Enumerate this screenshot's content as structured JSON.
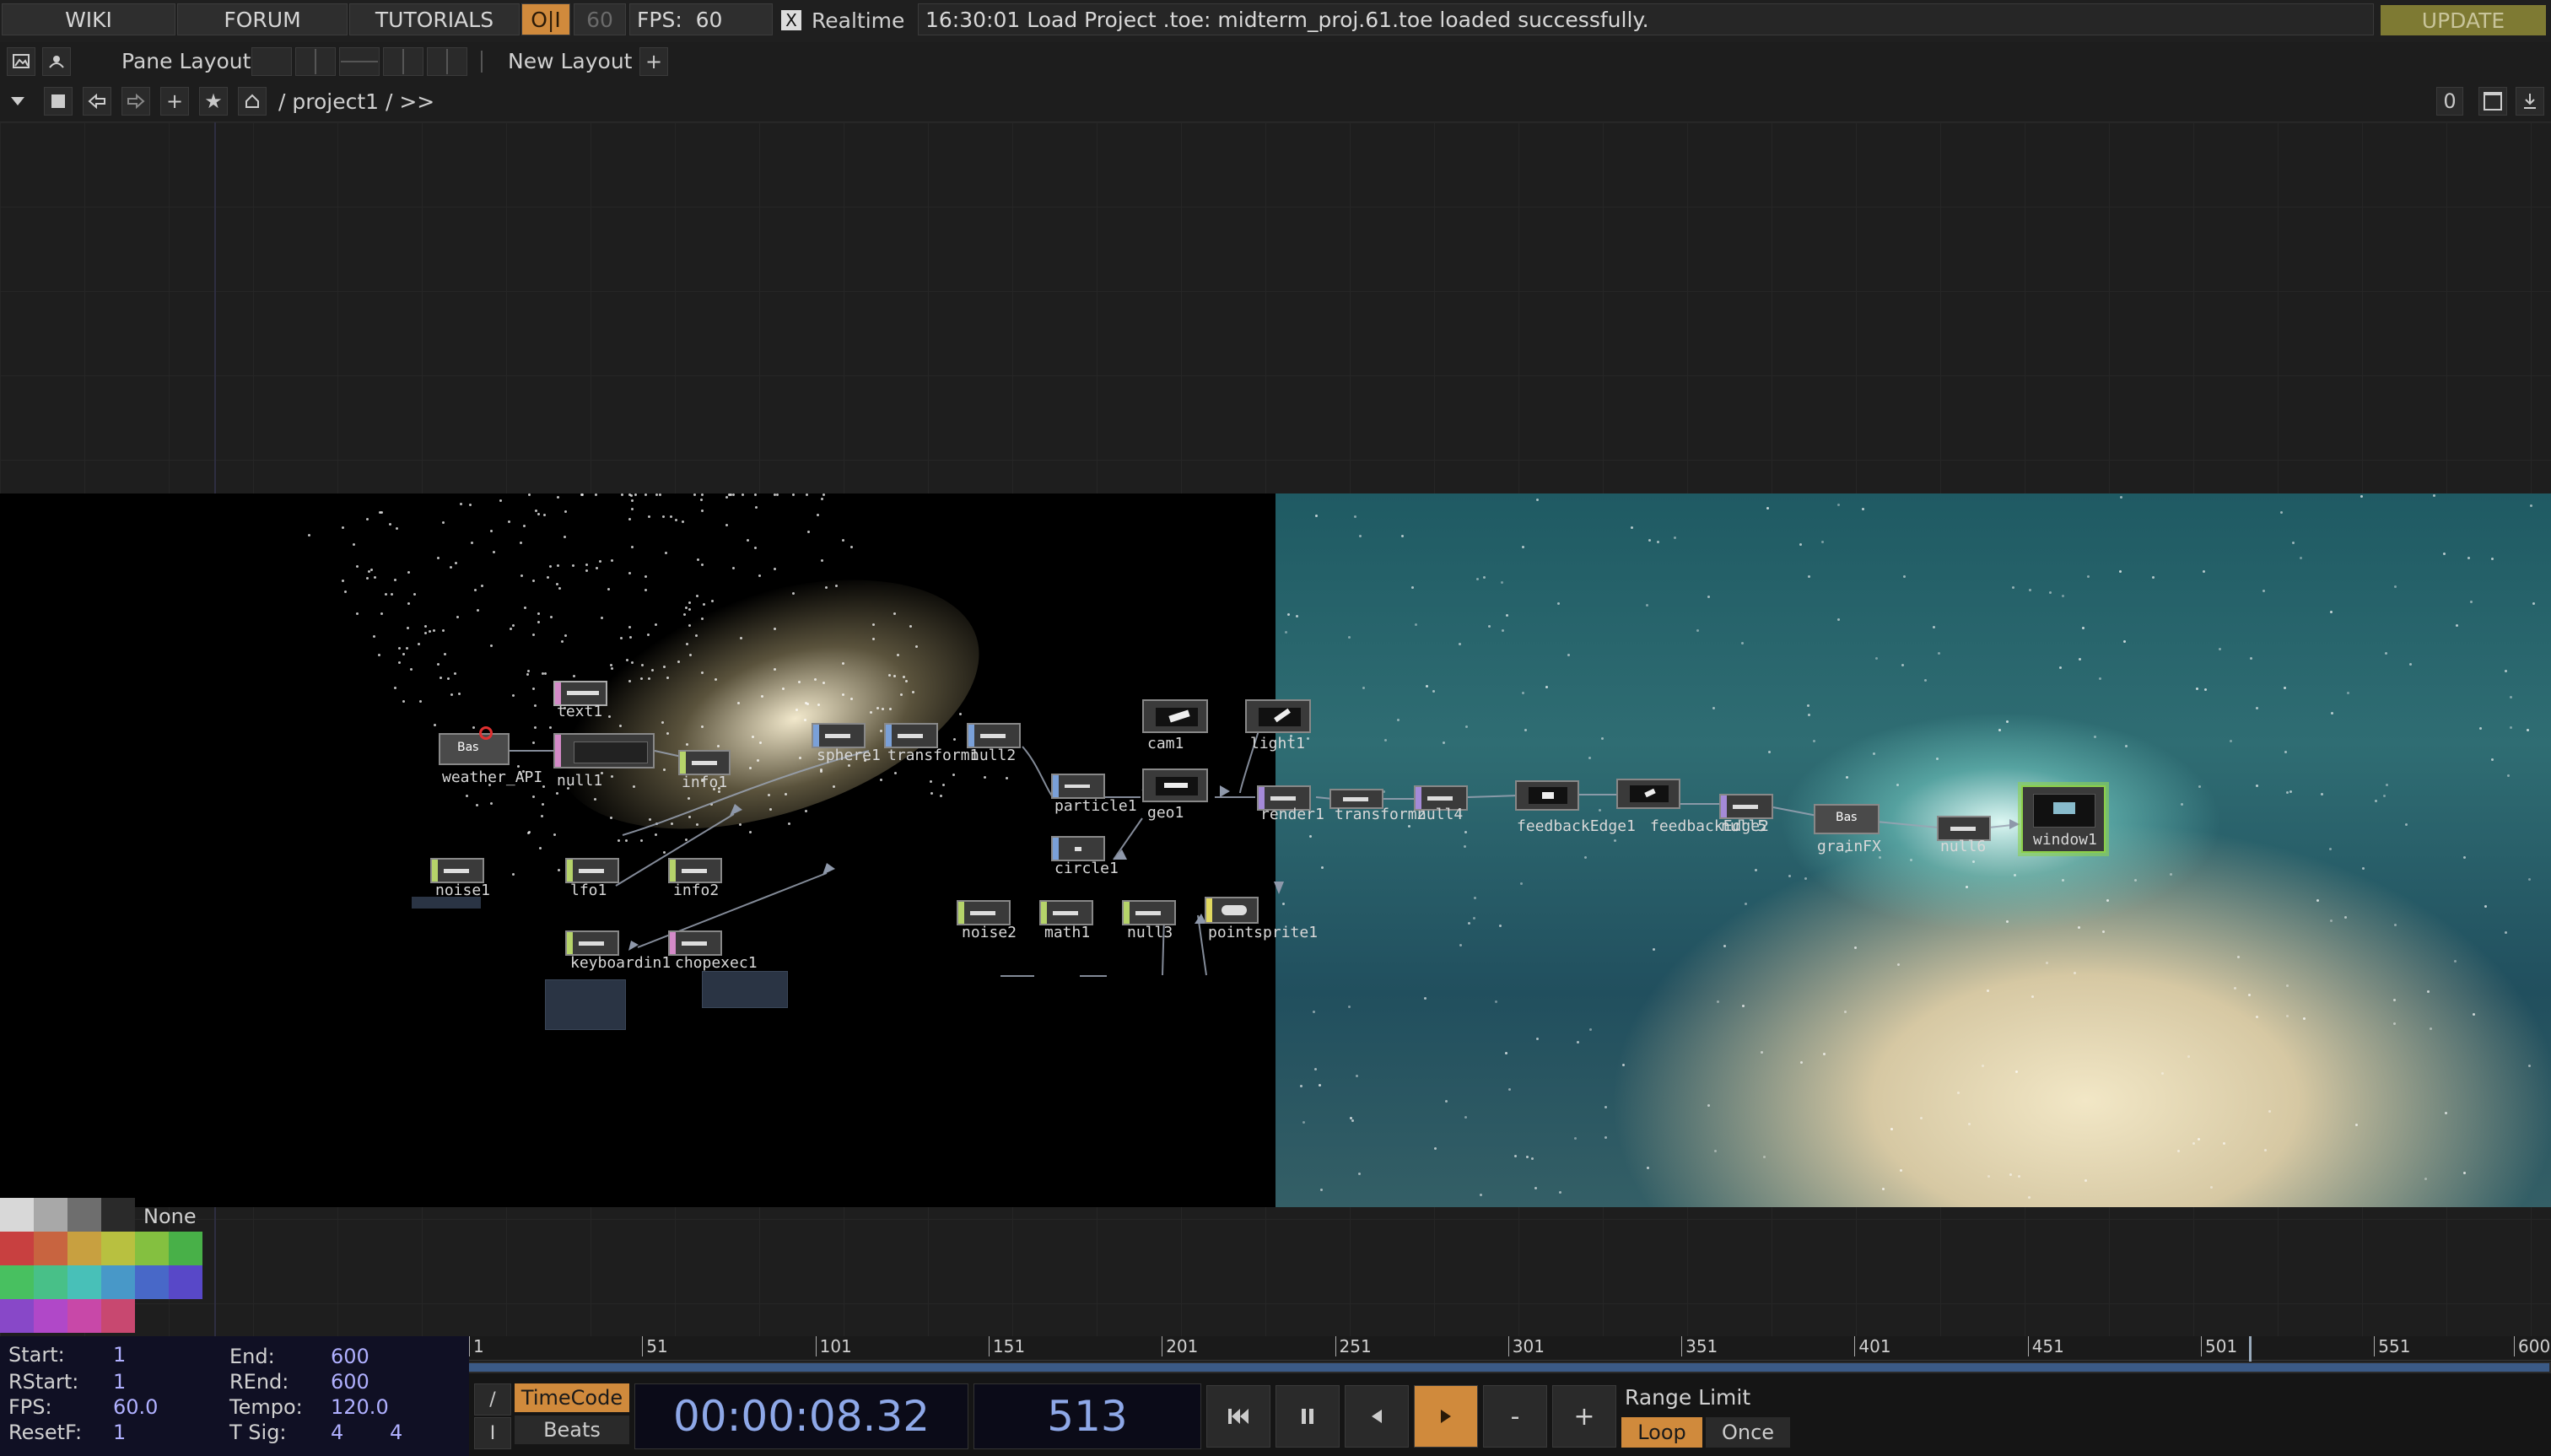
{
  "topbar": {
    "wiki": "WIKI",
    "forum": "FORUM",
    "tutorials": "TUTORIALS",
    "oi": "O|I",
    "fps_target": "60",
    "fps_label": "FPS:",
    "fps_value": "60",
    "realtime_check": "X",
    "realtime_label": "Realtime",
    "status_message": "16:30:01 Load Project .toe: midterm_proj.61.toe loaded successfully.",
    "update": "UPDATE"
  },
  "panebar": {
    "pane_layout": "Pane Layout",
    "new_layout": "New Layout",
    "plus": "+"
  },
  "pathbar": {
    "path": "/ project1 / >>",
    "counter": "0"
  },
  "nodes": [
    {
      "id": "text1",
      "label": "text1"
    },
    {
      "id": "weather_api",
      "label": "weather_API",
      "badge": "Bas"
    },
    {
      "id": "null1",
      "label": "null1"
    },
    {
      "id": "info1",
      "label": "info1"
    },
    {
      "id": "sphere1",
      "label": "sphere1"
    },
    {
      "id": "transform1",
      "label": "transform1"
    },
    {
      "id": "null2",
      "label": "null2"
    },
    {
      "id": "cam1",
      "label": "cam1"
    },
    {
      "id": "light1",
      "label": "light1"
    },
    {
      "id": "particle1",
      "label": "particle1"
    },
    {
      "id": "geo1",
      "label": "geo1"
    },
    {
      "id": "circle1",
      "label": "circle1"
    },
    {
      "id": "noise1",
      "label": "noise1"
    },
    {
      "id": "lfo1",
      "label": "lfo1"
    },
    {
      "id": "info2",
      "label": "info2"
    },
    {
      "id": "keyboardin1",
      "label": "keyboardin1"
    },
    {
      "id": "chopexec1",
      "label": "chopexec1"
    },
    {
      "id": "noise2",
      "label": "noise2"
    },
    {
      "id": "math1",
      "label": "math1"
    },
    {
      "id": "null3",
      "label": "null3"
    },
    {
      "id": "pointsprite1",
      "label": "pointsprite1"
    },
    {
      "id": "render1",
      "label": "render1"
    },
    {
      "id": "transform2",
      "label": "transform2"
    },
    {
      "id": "null4",
      "label": "null4"
    },
    {
      "id": "feedbackedge1",
      "label": "feedbackEdge1"
    },
    {
      "id": "feedbackedge2",
      "label": "feedbackEdge2"
    },
    {
      "id": "null5",
      "label": "null5"
    },
    {
      "id": "grainfx",
      "label": "grainFX",
      "badge": "Bas"
    },
    {
      "id": "null6",
      "label": "null6"
    },
    {
      "id": "window1",
      "label": "window1"
    }
  ],
  "palette": {
    "none": "None",
    "colors": [
      "#d8d8d8",
      "#a8a8a8",
      "#6e6e6e",
      "#2a2a2a",
      "#c84040",
      "#c86440",
      "#c8a040",
      "#b8c040",
      "#84c040",
      "#48b048",
      "#48c060",
      "#48c088",
      "#48c0b8",
      "#4898c8",
      "#4868c8",
      "#5848c8",
      "#8848c8",
      "#b048c8",
      "#c848a8",
      "#c84870"
    ]
  },
  "stats": {
    "start_label": "Start:",
    "start": "1",
    "end_label": "End:",
    "end": "600",
    "rstart_label": "RStart:",
    "rstart": "1",
    "rend_label": "REnd:",
    "rend": "600",
    "fps_label": "FPS:",
    "fps": "60.0",
    "tempo_label": "Tempo:",
    "tempo": "120.0",
    "resetf_label": "ResetF:",
    "resetf": "1",
    "tsig_label": "T Sig:",
    "tsig_a": "4",
    "tsig_b": "4"
  },
  "timeline": {
    "ticks": [
      "1",
      "51",
      "101",
      "151",
      "201",
      "251",
      "301",
      "351",
      "401",
      "451",
      "501",
      "551",
      "600"
    ],
    "progress": 0.855,
    "timecode_label": "TimeCode",
    "beats_label": "Beats",
    "slash": "/",
    "i_label": "I",
    "timecode": "00:00:08.32",
    "frame": "513",
    "minus": "-",
    "plus": "+",
    "range_limit": "Range Limit",
    "loop": "Loop",
    "once": "Once"
  }
}
